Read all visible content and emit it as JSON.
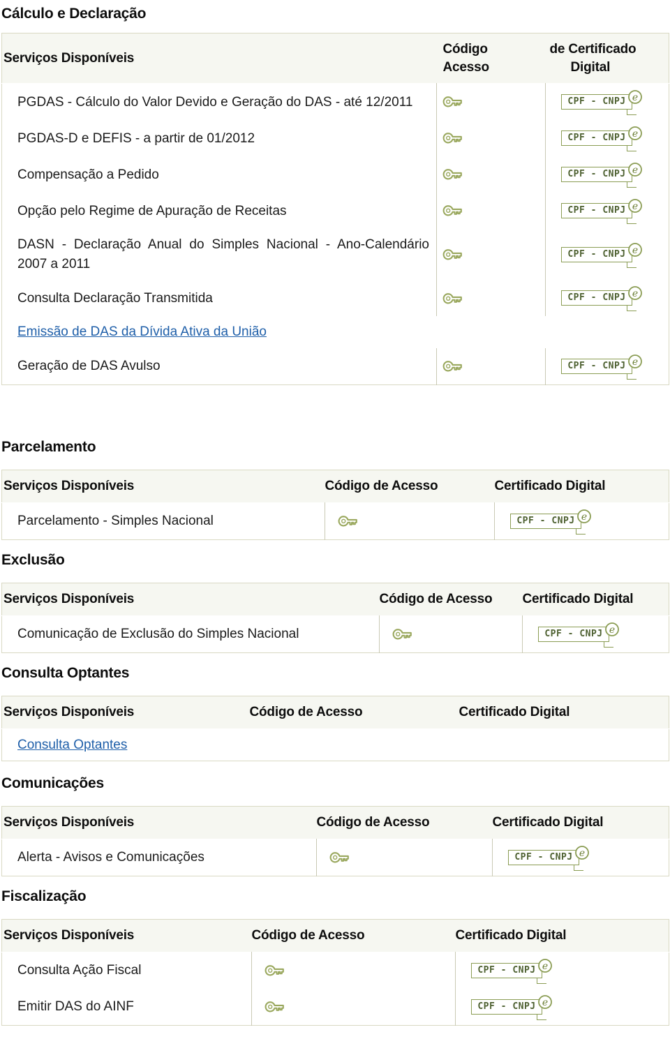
{
  "colors": {
    "accent_green": "#8a9c53",
    "badge_text": "#4d6030",
    "link_blue": "#1f5fa9",
    "header_bg": "#f6f7f1",
    "table_border": "#d9d9c3"
  },
  "icons": {
    "key": "key-icon",
    "certificate_badge": "cpf-cnpj-certificate-icon",
    "e_circle": "e-circle-icon"
  },
  "badge_label": "CPF - CNPJ",
  "badge_e": "e",
  "sections": [
    {
      "id": "calculo-e-declaracao",
      "title": "Cálculo e Declaração",
      "headers": {
        "services": "Serviços Disponíveis",
        "code_line1": "Código",
        "code_line2": "Acesso",
        "cert_line1": "de Certificado",
        "cert_line2": "Digital"
      },
      "rows": [
        {
          "label": "PGDAS - Cálculo do Valor Devido e Geração do DAS - até 12/2011",
          "justify": true,
          "key": true,
          "cert": true,
          "link": false
        },
        {
          "label": "PGDAS-D e DEFIS - a partir de 01/2012",
          "justify": false,
          "key": true,
          "cert": true,
          "link": false
        },
        {
          "label": "Compensação a Pedido",
          "justify": false,
          "key": true,
          "cert": true,
          "link": false
        },
        {
          "label": "Opção pelo Regime de Apuração de Receitas",
          "justify": false,
          "key": true,
          "cert": true,
          "link": false
        },
        {
          "label": "DASN - Declaração Anual do Simples Nacional - Ano-Calendário 2007 a 2011",
          "justify": true,
          "key": true,
          "cert": true,
          "link": false
        },
        {
          "label": "Consulta Declaração Transmitida",
          "justify": false,
          "key": true,
          "cert": true,
          "link": false
        },
        {
          "label": "Emissão de DAS da Dívida Ativa da União",
          "justify": false,
          "key": false,
          "cert": false,
          "link": true
        },
        {
          "label": "Geração de DAS Avulso",
          "justify": false,
          "key": true,
          "cert": true,
          "link": false
        }
      ]
    },
    {
      "id": "parcelamento",
      "title": "Parcelamento",
      "headers": {
        "services": "Serviços Disponíveis",
        "code": "Código de Acesso",
        "cert": "Certificado Digital"
      },
      "rows": [
        {
          "label": "Parcelamento - Simples Nacional",
          "key": true,
          "cert": true,
          "link": false
        }
      ]
    },
    {
      "id": "exclusao",
      "title": "Exclusão",
      "headers": {
        "services": "Serviços Disponíveis",
        "code": "Código de Acesso",
        "cert": "Certificado Digital"
      },
      "rows": [
        {
          "label": "Comunicação de Exclusão do Simples Nacional",
          "key": true,
          "cert": true,
          "link": false
        }
      ]
    },
    {
      "id": "consulta-optantes",
      "title": "Consulta Optantes",
      "headers": {
        "services": "Serviços Disponíveis",
        "code": "Código de Acesso",
        "cert": "Certificado Digital"
      },
      "rows": [
        {
          "label": "Consulta Optantes",
          "key": false,
          "cert": false,
          "link": true
        }
      ]
    },
    {
      "id": "comunicacoes",
      "title": "Comunicações",
      "headers": {
        "services": "Serviços Disponíveis",
        "code": "Código de Acesso",
        "cert": "Certificado Digital"
      },
      "rows": [
        {
          "label": "Alerta - Avisos e Comunicações",
          "key": true,
          "cert": true,
          "link": false
        }
      ]
    },
    {
      "id": "fiscalizacao",
      "title": "Fiscalização",
      "headers": {
        "services": "Serviços Disponíveis",
        "code": "Código de Acesso",
        "cert": "Certificado Digital"
      },
      "rows": [
        {
          "label": "Consulta Ação Fiscal",
          "key": true,
          "cert": true,
          "link": false
        },
        {
          "label": "Emitir DAS do AINF",
          "key": true,
          "cert": true,
          "link": false
        }
      ]
    }
  ]
}
